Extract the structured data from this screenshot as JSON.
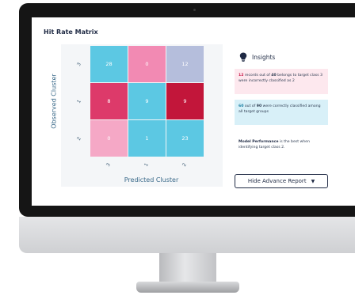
{
  "page": {
    "title": "Hit Rate Matrix"
  },
  "matrix": {
    "y_label": "Observed Cluster",
    "x_label": "Predicted Cluster",
    "row_ticks": [
      "3",
      "1",
      "2"
    ],
    "col_ticks": [
      "3",
      "1",
      "2"
    ],
    "rows": [
      [
        {
          "value": "28",
          "color": "#5cc8e3"
        },
        {
          "value": "0",
          "color": "#f28ab3"
        },
        {
          "value": "12",
          "color": "#b5bedc"
        }
      ],
      [
        {
          "value": "8",
          "color": "#dd3a6a"
        },
        {
          "value": "9",
          "color": "#5cc8e3"
        },
        {
          "value": "9",
          "color": "#c2163a"
        }
      ],
      [
        {
          "value": "0",
          "color": "#f5a8c6"
        },
        {
          "value": "1",
          "color": "#5cc8e3"
        },
        {
          "value": "23",
          "color": "#5cc8e3"
        }
      ]
    ]
  },
  "insights": {
    "heading": "Insights",
    "icon": "lightbulb-icon",
    "card1": {
      "num1": "12",
      "t1": " records out of ",
      "num2": "40",
      "t2": " belongs to target class 3 were incorrectly classified as 2"
    },
    "card2": {
      "num1": "60",
      "t1": " out of ",
      "num2": "90",
      "t2": " were correctly classified among all target groups"
    },
    "card3": {
      "bold": "Model Performance",
      "rest": " is the best when identifying target class 2."
    }
  },
  "buttons": {
    "advance_report": "Hide Advance Report"
  }
}
